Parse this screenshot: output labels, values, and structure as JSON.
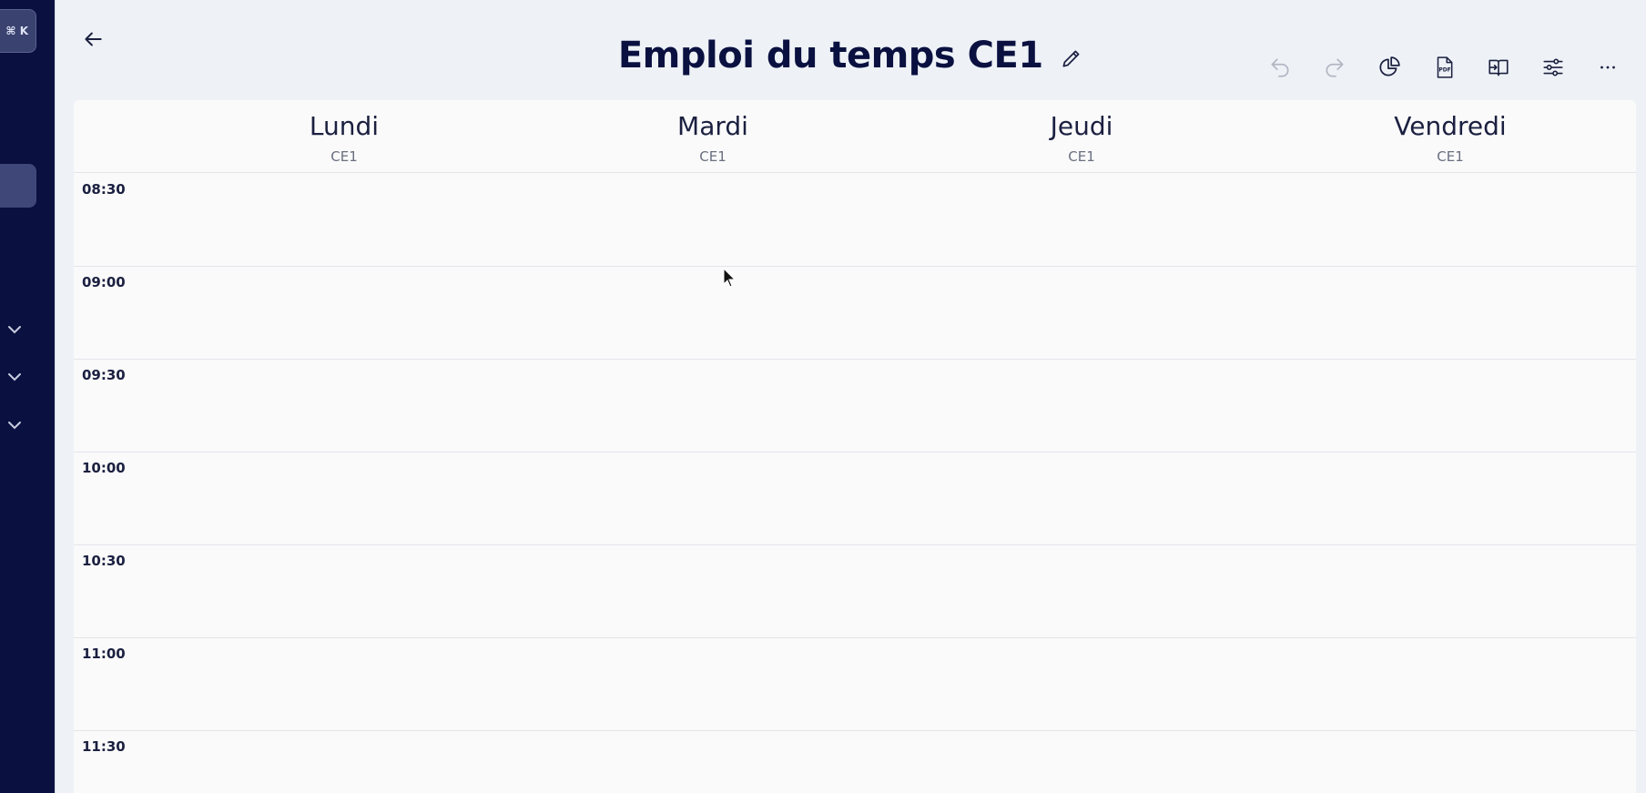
{
  "sidebar": {
    "shortcut": "⌘ K",
    "chevrons": [
      "chevron-down-icon",
      "chevron-down-icon",
      "chevron-down-icon"
    ]
  },
  "header": {
    "title": "Emploi du temps CE1",
    "icons": [
      "arrow-left-icon",
      "pencil-icon"
    ]
  },
  "toolbar": {
    "buttons": [
      "undo-icon",
      "redo-icon",
      "pie-chart-icon",
      "pdf-icon",
      "book-open-icon",
      "sliders-icon",
      "more-icon"
    ],
    "pdf_label": "PDF"
  },
  "days": [
    {
      "name": "Lundi",
      "class": "CE1"
    },
    {
      "name": "Mardi",
      "class": "CE1"
    },
    {
      "name": "Jeudi",
      "class": "CE1"
    },
    {
      "name": "Vendredi",
      "class": "CE1"
    }
  ],
  "slots": [
    "08:30",
    "09:00",
    "09:30",
    "10:00",
    "10:30",
    "11:00",
    "11:30"
  ],
  "colors": {
    "sidebar": "#0a1140",
    "title": "#0a1140",
    "background": "#eef2f7",
    "grid": "#fafafa"
  }
}
